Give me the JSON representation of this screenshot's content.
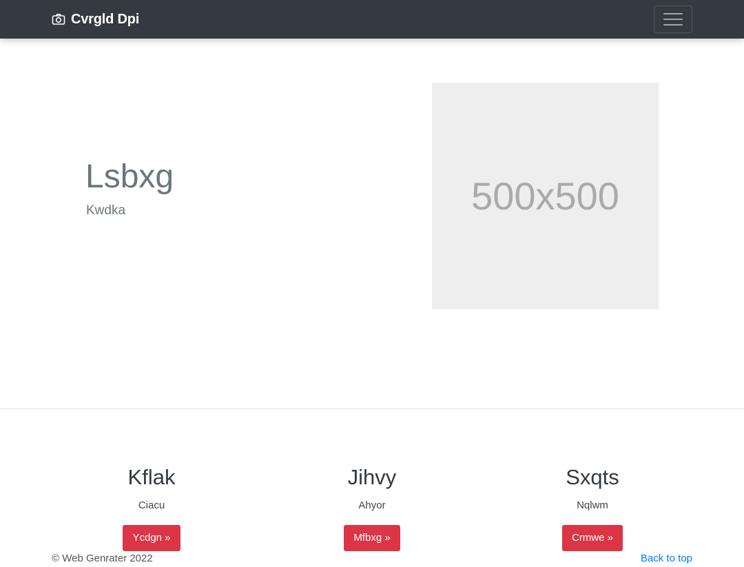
{
  "navbar": {
    "brand_icon": "camera-icon",
    "brand_text": "Cvrgld Dpi",
    "toggler_icon": "hamburger-menu-icon",
    "background": "#343a40"
  },
  "hero": {
    "title": "Lsbxg",
    "subtitle": "Kwdka",
    "image_placeholder": "500x500"
  },
  "features": [
    {
      "title": "Kflak",
      "text": "Ciacu",
      "button": "Ycdgn »"
    },
    {
      "title": "Jihvy",
      "text": "Ahyor",
      "button": "Mfbxg »"
    },
    {
      "title": "Sxqts",
      "text": "Nqlwm",
      "button": "Crmwe »"
    }
  ],
  "footer": {
    "copyright": "© Web Genrater 2022",
    "back_to_top": "Back to top"
  },
  "colors": {
    "button": "#dc3545",
    "link": "#007bff"
  }
}
